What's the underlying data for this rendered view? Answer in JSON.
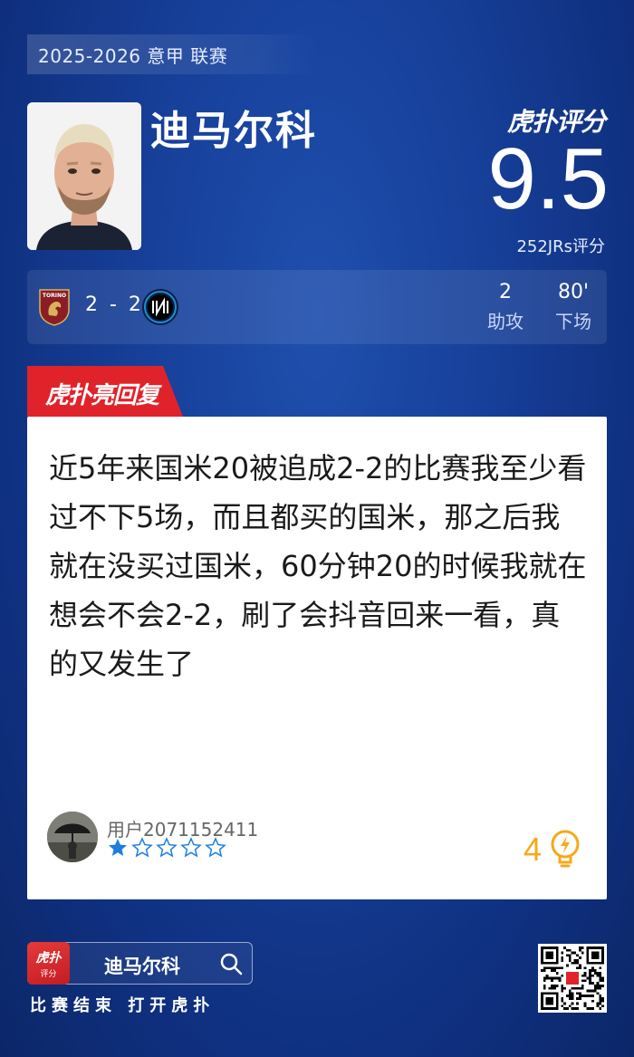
{
  "header": {
    "league": "2025-2026 意甲 联赛",
    "player_name": "迪马尔科",
    "brand": "虎扑评分",
    "rating": "9.5",
    "rating_count": "252JRs评分"
  },
  "match": {
    "score": "2 - 2",
    "home_team_icon": "torino-badge-icon",
    "away_team_icon": "inter-badge-icon",
    "stats": [
      {
        "value": "2",
        "label": "助攻"
      },
      {
        "value": "80'",
        "label": "下场"
      }
    ]
  },
  "reply": {
    "tag": "虎扑亮回复",
    "text": "近5年来国米20被追成2-2的比赛我至少看过不下5场，而且都买的国米，那之后我就在没买过国米，60分钟20的时候我就在想会不会2-2，刷了会抖音回来一看，真的又发生了",
    "user": "用户2071152411",
    "stars": 1,
    "stars_total": 5,
    "likes": "4"
  },
  "footer": {
    "app_icon_title": "虎扑",
    "app_icon_sub": "评分",
    "search_text": "迪马尔科",
    "caption": "比赛结束 打开虎扑"
  },
  "colors": {
    "background": "#163f98",
    "accent_red": "#e0232b",
    "star_blue": "#1e7de0",
    "like_orange": "#f5a91a"
  }
}
